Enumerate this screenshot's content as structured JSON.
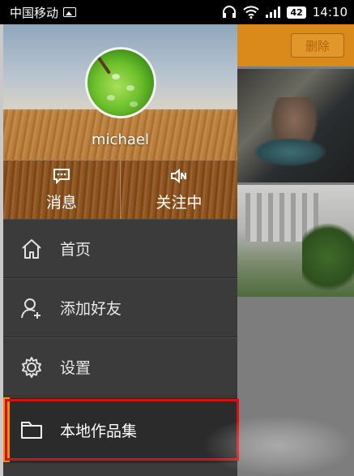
{
  "status_bar": {
    "carrier": "中国移动",
    "battery": "42",
    "time": "14:10"
  },
  "background": {
    "delete_label": "删除"
  },
  "profile": {
    "username": "michael"
  },
  "actions": [
    {
      "label": "消息",
      "icon": "message-icon"
    },
    {
      "label": "关注中",
      "icon": "speaker-mute-icon"
    }
  ],
  "menu": [
    {
      "label": "首页",
      "icon": "home-icon"
    },
    {
      "label": "添加好友",
      "icon": "add-user-icon"
    },
    {
      "label": "设置",
      "icon": "gear-icon"
    },
    {
      "label": "本地作品集",
      "icon": "folder-icon",
      "active": true
    }
  ],
  "colors": {
    "accent": "#f08a10",
    "highlight_border": "#d9100f",
    "drawer_bg": "#3b3b3b"
  }
}
